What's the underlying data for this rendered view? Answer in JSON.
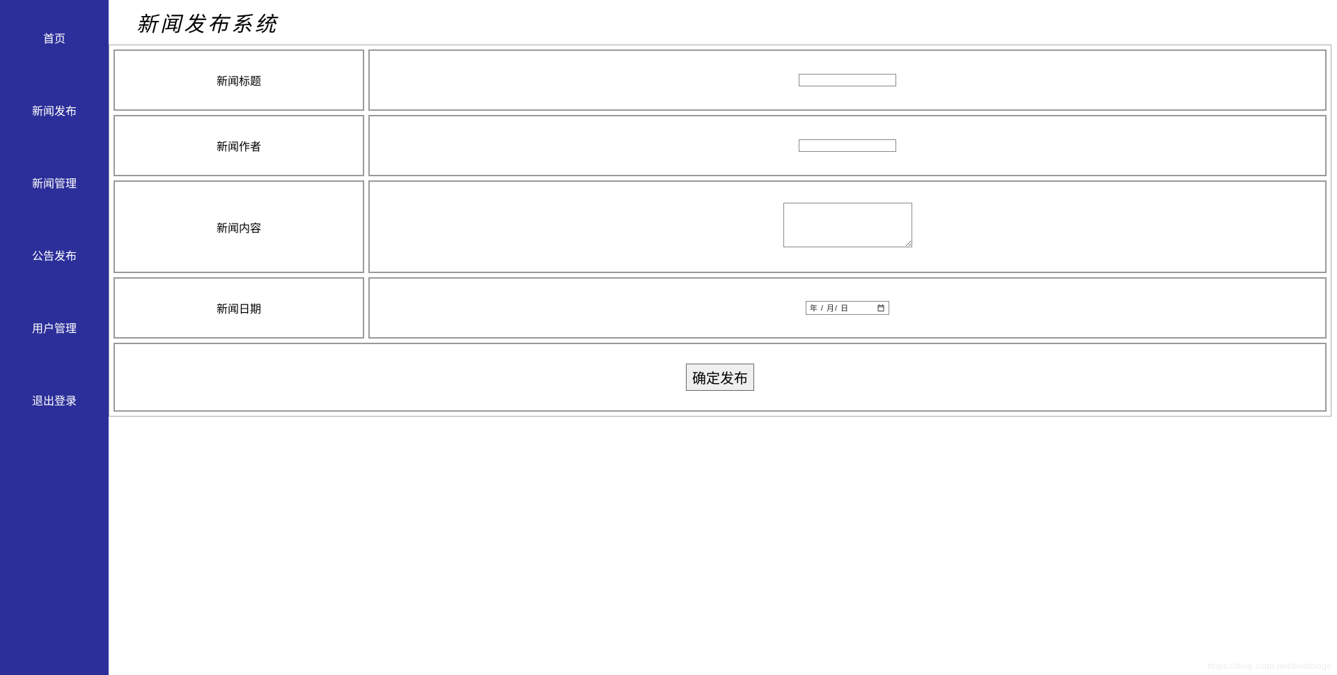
{
  "sidebar": {
    "items": [
      {
        "label": "首页"
      },
      {
        "label": "新闻发布"
      },
      {
        "label": "新闻管理"
      },
      {
        "label": "公告发布"
      },
      {
        "label": "用户管理"
      },
      {
        "label": "退出登录"
      }
    ]
  },
  "header": {
    "title": "新闻发布系统"
  },
  "form": {
    "fields": [
      {
        "label": "新闻标题",
        "type": "text",
        "value": ""
      },
      {
        "label": "新闻作者",
        "type": "text",
        "value": ""
      },
      {
        "label": "新闻内容",
        "type": "textarea",
        "value": ""
      },
      {
        "label": "新闻日期",
        "type": "date",
        "placeholder": "年 / 月/ 日"
      }
    ],
    "submit_label": "确定发布"
  },
  "watermark": "https://blog.csdn.net/bestblogs"
}
